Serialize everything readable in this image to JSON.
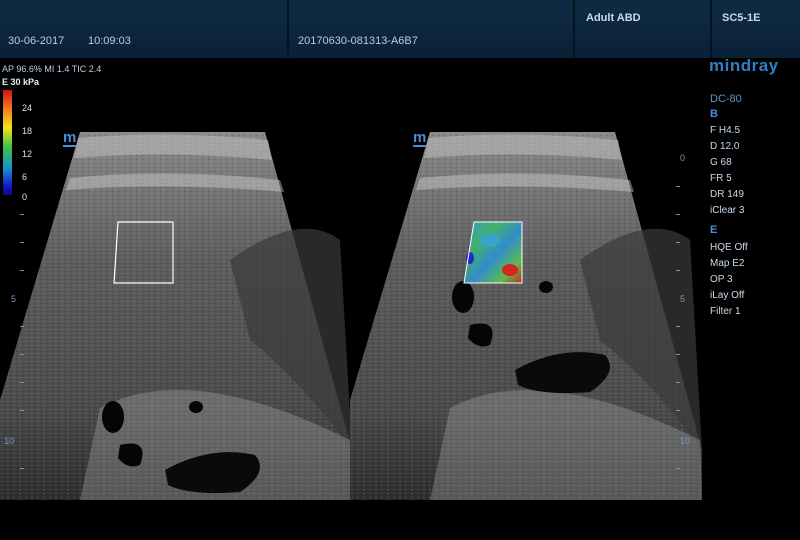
{
  "header": {
    "date": "30-06-2017",
    "time": "10:09:03",
    "study_id": "20170630-081313-A6B7",
    "preset": "Adult ABD",
    "probe": "SC5-1E"
  },
  "acquisition": {
    "info_line": "AP 96.6%  MI 1.4  TIC 2.4",
    "elasto_scale_label": "E 30 kPa",
    "colorbar_ticks": [
      "24",
      "18",
      "12",
      "6",
      "0"
    ]
  },
  "brand": {
    "logo": "mindray",
    "model": "DC-80"
  },
  "params_b": {
    "mode": "B",
    "items": [
      "F H4.5",
      "D 12.0",
      "G 68",
      "FR 5",
      "DR 149",
      "iClear 3"
    ]
  },
  "params_e": {
    "mode": "E",
    "items": [
      "HQE Off",
      "Map E2",
      "OP 3",
      "iLay Off",
      "Filter 1"
    ]
  },
  "depth_labels": {
    "top": "0",
    "mid": "5",
    "bottom": "10"
  },
  "orientation_marker": "m",
  "colors": {
    "header_bg": "#0f2b44",
    "accent_blue": "#2f7fc4",
    "text": "#c9daec"
  }
}
